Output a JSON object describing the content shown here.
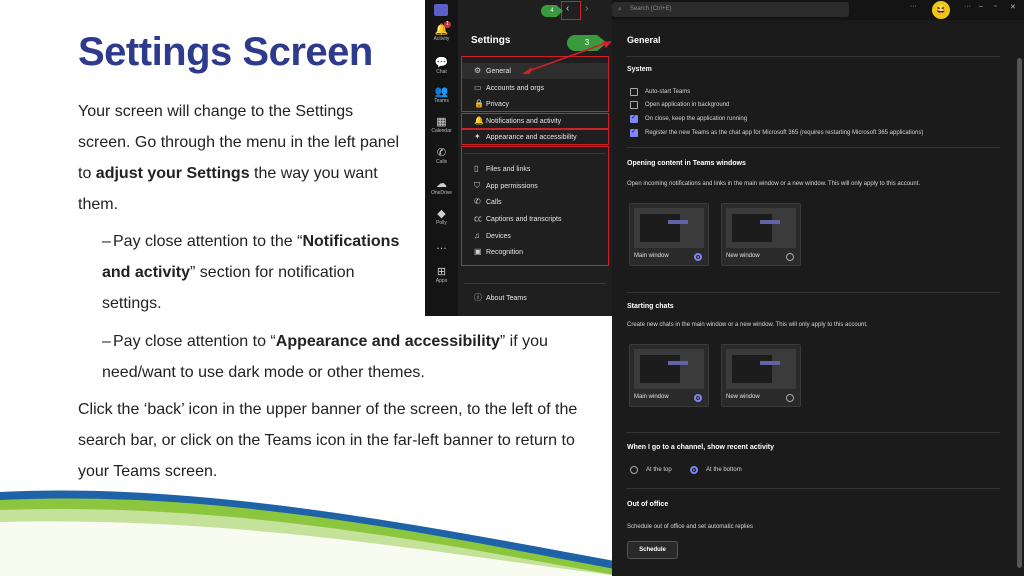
{
  "slide": {
    "title": "Settings Screen",
    "intro_before": "Your screen will change to the Settings screen. Go through the menu in the left panel to ",
    "intro_bold": "adjust your Settings",
    "intro_after": " the way you want them.",
    "bullet1_prefix": "Pay close attention to the “",
    "bullet1_bold": "Notifications and activity",
    "bullet1_suffix": "” section for notification settings.",
    "bullet2_prefix": "Pay close attention to “",
    "bullet2_bold": "Appearance and accessibility",
    "bullet2_suffix": "” if you need/want to use dark mode or other themes.",
    "closing": "Click the ‘back’ icon in the upper banner of the screen, to the left of the search bar, or click on the Teams icon in the far-left banner to return to your Teams screen.",
    "dash": "–"
  },
  "callouts": {
    "three": "3",
    "four": "4"
  },
  "teams": {
    "search_placeholder": "Search (Ctrl+E)",
    "rail": [
      {
        "label": "Activity",
        "icon": "bell-icon",
        "glyph": "🔔",
        "badge": "1"
      },
      {
        "label": "Chat",
        "icon": "chat-icon",
        "glyph": "💬"
      },
      {
        "label": "Teams",
        "icon": "teams-icon",
        "glyph": "👥"
      },
      {
        "label": "Calendar",
        "icon": "calendar-icon",
        "glyph": "▦"
      },
      {
        "label": "Calls",
        "icon": "phone-icon",
        "glyph": "✆"
      },
      {
        "label": "OneDrive",
        "icon": "cloud-icon",
        "glyph": "☁"
      },
      {
        "label": "Polly",
        "icon": "polly-icon",
        "glyph": "◆"
      },
      {
        "label": "",
        "icon": "more-icon",
        "glyph": "…"
      },
      {
        "label": "Apps",
        "icon": "apps-icon",
        "glyph": "⊞"
      }
    ],
    "settings_title": "Settings",
    "menu": [
      {
        "label": "General",
        "icon": "gear-icon",
        "glyph": "⚙"
      },
      {
        "label": "Accounts and orgs",
        "icon": "id-card-icon",
        "glyph": "▭"
      },
      {
        "label": "Privacy",
        "icon": "lock-icon",
        "glyph": "🔒"
      },
      {
        "label": "Notifications and activity",
        "icon": "bell-icon",
        "glyph": "🔔"
      },
      {
        "label": "Appearance and accessibility",
        "icon": "magic-wand-icon",
        "glyph": "✦"
      },
      {
        "label": "Files and links",
        "icon": "file-icon",
        "glyph": "▯"
      },
      {
        "label": "App permissions",
        "icon": "shield-icon",
        "glyph": "⛉"
      },
      {
        "label": "Calls",
        "icon": "phone-icon",
        "glyph": "✆"
      },
      {
        "label": "Captions and transcripts",
        "icon": "cc-icon",
        "glyph": "㏄"
      },
      {
        "label": "Devices",
        "icon": "headset-icon",
        "glyph": "♫"
      },
      {
        "label": "Recognition",
        "icon": "recognition-icon",
        "glyph": "▣"
      },
      {
        "label": "About Teams",
        "icon": "info-icon",
        "glyph": "ⓘ"
      }
    ],
    "general": {
      "title": "General",
      "system_heading": "System",
      "checkboxes": [
        {
          "label": "Auto-start Teams",
          "checked": false
        },
        {
          "label": "Open application in background",
          "checked": false
        },
        {
          "label": "On close, keep the application running",
          "checked": true
        },
        {
          "label": "Register the new Teams as the chat app for Microsoft 365 (requires restarting Microsoft 365 applications)",
          "checked": true
        }
      ],
      "opening_heading": "Opening content in Teams windows",
      "opening_desc": "Open incoming notifications and links in the main window or a new window. This will only apply to this account.",
      "opening_options": [
        {
          "label": "Main window",
          "selected": true
        },
        {
          "label": "New window",
          "selected": false
        }
      ],
      "chats_heading": "Starting chats",
      "chats_desc": "Create new chats in the main window or a new window. This will only apply to this account.",
      "chats_options": [
        {
          "label": "Main window",
          "selected": true
        },
        {
          "label": "New window",
          "selected": false
        }
      ],
      "channel_heading": "When I go to a channel, show recent activity",
      "channel_options": [
        {
          "label": "At the top",
          "selected": false
        },
        {
          "label": "At the bottom",
          "selected": true
        }
      ],
      "ooo_heading": "Out of office",
      "ooo_desc": "Schedule out of office and set automatic replies",
      "schedule_button": "Schedule"
    }
  },
  "colors": {
    "title": "#2e3a8c",
    "callout": "#3a9b3e",
    "highlight": "#d0202a",
    "accent": "#7f85f5"
  }
}
